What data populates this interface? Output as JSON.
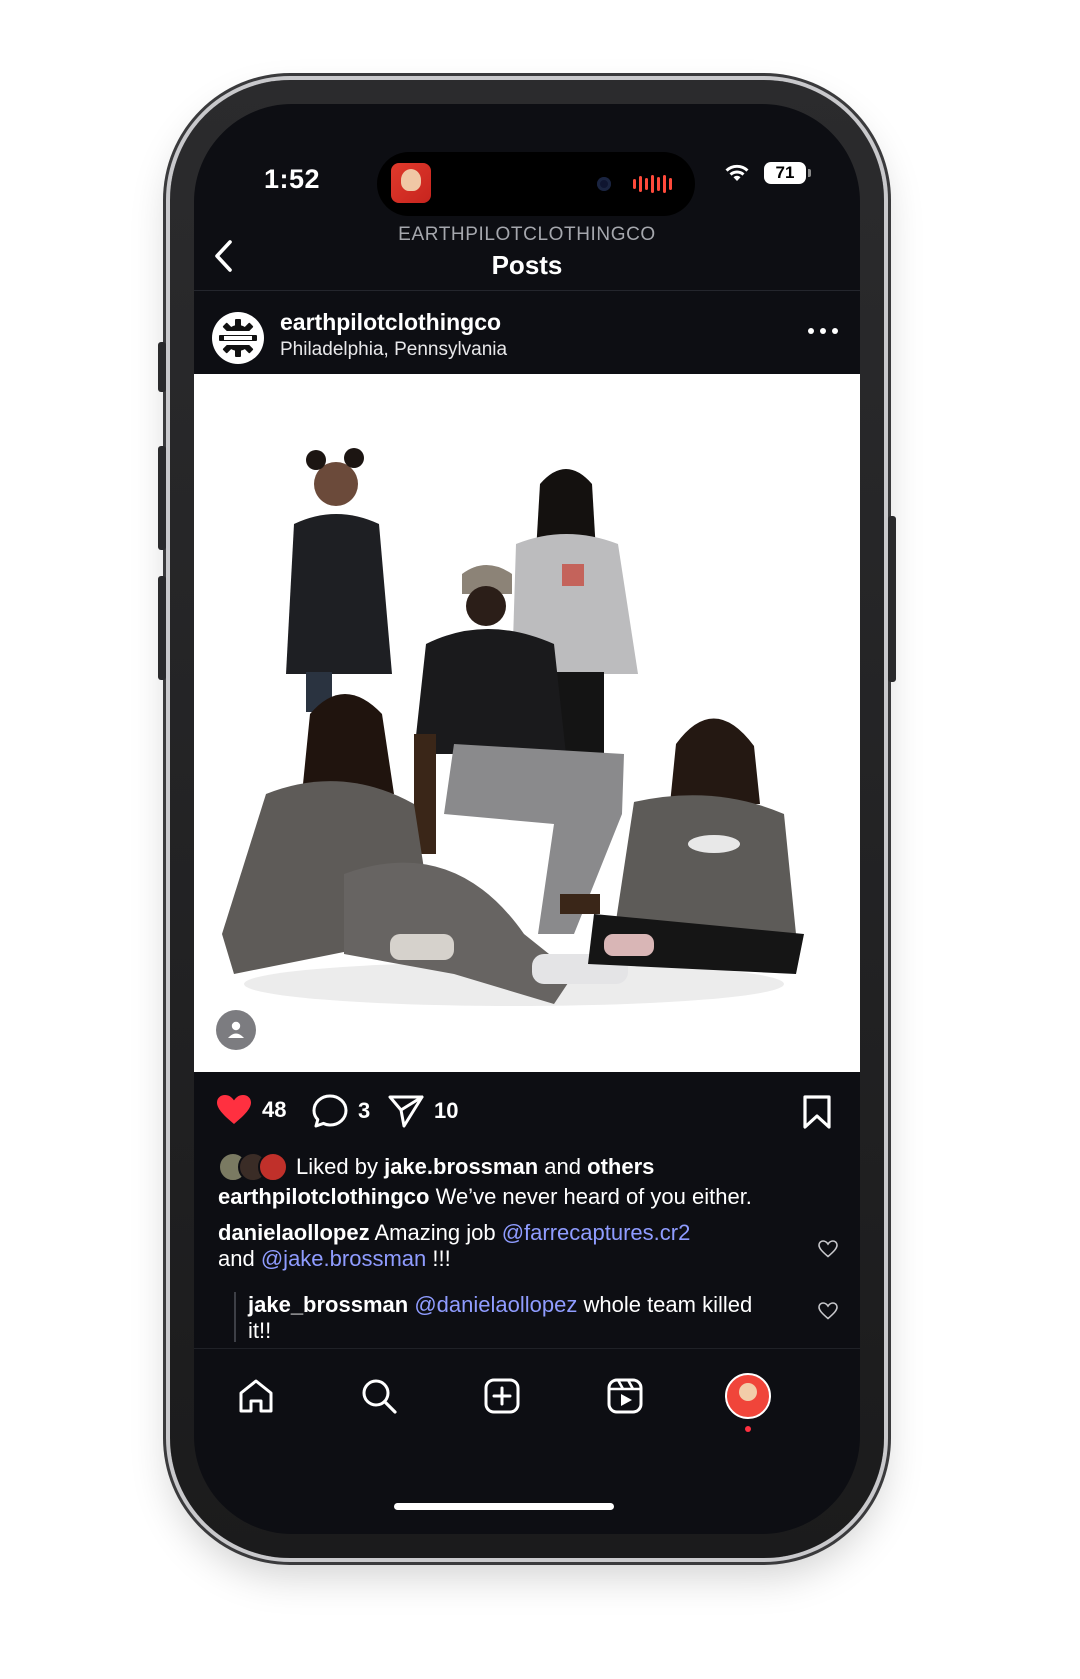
{
  "status_bar": {
    "time": "1:52",
    "battery": "71"
  },
  "header": {
    "account_caps": "EARTHPILOTCLOTHINGCO",
    "title": "Posts"
  },
  "post": {
    "username": "earthpilotclothingco",
    "location": "Philadelphia, Pennsylvania",
    "likes_count": "48",
    "comments_count": "3",
    "shares_count": "10",
    "liked_by_prefix": "Liked by",
    "liked_by_user": "jake.brossman",
    "liked_by_and": "and",
    "liked_by_others": "others",
    "caption_user": "earthpilotclothingco",
    "caption_text": "We’ve never heard of you either."
  },
  "comments": [
    {
      "user": "danielaollopez",
      "text_1": "Amazing job",
      "mention_1": "@farrecaptures.cr2",
      "text_2": "and",
      "mention_2": "@jake.brossman",
      "text_3": "!!!"
    },
    {
      "user": "jake_brossman",
      "mention_1": "@danielaollopez",
      "text_1": "whole team killed it!!"
    }
  ],
  "colors": {
    "background": "#0d0e13",
    "like_red": "#ff3040",
    "mention_blue": "#8f9cff"
  },
  "icons": [
    "back-icon",
    "more-icon",
    "heart-filled-icon",
    "comment-icon",
    "share-icon",
    "bookmark-icon",
    "tag-people-icon",
    "home-icon",
    "search-icon",
    "create-icon",
    "reels-icon",
    "profile-avatar"
  ]
}
